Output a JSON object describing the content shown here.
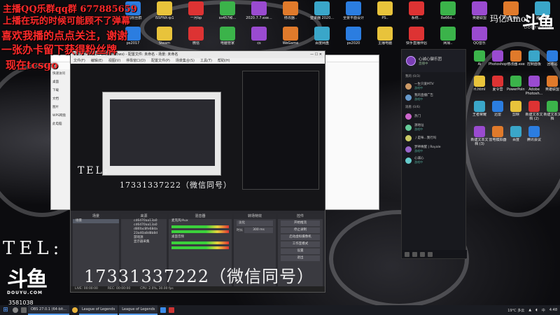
{
  "overlay": {
    "line1": "主播QQ乐群qq群 677885659",
    "line2": "上播在玩的时候可能顾不了弹幕",
    "line3": "喜欢我播的点点关注，谢谢",
    "line4": "一张办卡留下获得粉丝牌",
    "line5": "现在tcsgo"
  },
  "contact": {
    "tel_label": "TEL:",
    "phone": "17331337222（微信同号）",
    "tel_label_small": "TEL:",
    "phone_small": "17331337222（微信同号）"
  },
  "branding": {
    "streamer_name": "玛亿Amor",
    "logo_text": "斗鱼",
    "logo_domain": "DOUYU.COM",
    "viewer_count": "3581038"
  },
  "obs": {
    "title": "OBS 27.0.1 (64-bit, windows) - 配置文件: 未命名 - 场景: 未命名",
    "menu": [
      "文件(F)",
      "编辑(E)",
      "视图(V)",
      "停靠窗口(D)",
      "配置文件(P)",
      "场景集合(S)",
      "工具(T)",
      "帮助(H)"
    ],
    "panels": {
      "scenes": "场景",
      "sources": "来源",
      "mixer": "混音器",
      "transitions": "转场特效",
      "controls": "控件"
    },
    "scene_item": "场景",
    "sources": [
      "cd6470aa13a0",
      "cd6470aa13a0",
      "d86fac8fe68da",
      "23a40a8d8b8d",
      "游戏源",
      "显示器采集"
    ],
    "mixer_tracks": [
      "麦克风/Aux",
      "桌面音频"
    ],
    "transition_label": "淡化",
    "duration_label": "时长",
    "duration_value": "300 ms",
    "control_buttons": [
      "开始推流",
      "停止录制",
      "启动虚拟摄像机",
      "工作室模式",
      "设置",
      "退出"
    ],
    "status": {
      "live": "LIVE: 00:00:00",
      "rec": "REC: 00:00:00",
      "cpu": "CPU: 2.0%, 30.00 fps"
    }
  },
  "explorer": {
    "sidebar": [
      "快速访问",
      "桌面",
      "下载",
      "文档",
      "图片",
      "WPS网盘",
      "此电脑"
    ]
  },
  "chat": {
    "channel_name": "心诚心御乐团",
    "channel_sub": "直播中",
    "sections": [
      "我的 (0/3)",
      "观看 (0/6)"
    ],
    "users": [
      {
        "name": "一生只爱MTV",
        "sub": "游戏中"
      },
      {
        "name": "我的直播广告",
        "sub": "游戏中"
      },
      {
        "name": "热门",
        "sub": ""
      },
      {
        "name": "源地址",
        "sub": "游戏中"
      },
      {
        "name": "丿是咪...我行吗",
        "sub": ""
      },
      {
        "name": "梦神唤醒 | Royale",
        "sub": "游戏中"
      },
      {
        "name": "心诚心",
        "sub": "游戏中"
      }
    ]
  },
  "taskbar": {
    "apps": [
      "OBS 27.0.1 (64-bit...",
      "League of Legends",
      "League of Legends"
    ],
    "tray_temp": "19°C 多云",
    "tray_lang": "中",
    "time": "4:48"
  },
  "desktop_icons": [
    "主播粉丝群",
    "iSSFNX-ip1",
    "一月bp",
    "ss457和...",
    "2020.7.7.exe...",
    "修改器..",
    "登录器 2020...",
    "全景平面设计",
    "PS..",
    "系统...",
    "8a66d...",
    "英雄联盟",
    "网易云音乐",
    "腾讯QQ",
    "ps2017",
    "Steam",
    "微信",
    "电脑管家",
    "cs",
    "WeGame",
    "百度网盘",
    "ps2020",
    "主播电脑",
    "快手直播伴侣",
    "网易..",
    "QQ音乐"
  ],
  "desktop_icons_right": [
    "Ai",
    "Photoshop",
    "修改器.exe",
    "控制面板",
    "回收站",
    "rt.html",
    "夏令营",
    "PowerPoint",
    "Adobe Photosh...",
    "英雄联盟",
    "王者荣耀",
    "迅雷",
    "剪映",
    "新建文本文档 (2)",
    "新建文本文档",
    "新建文本文档 (3)",
    "雷电模拟器",
    "百度",
    "腾讯会议"
  ],
  "colors": {
    "overlay_red": "#ff2a2a",
    "accent_blue": "#5aa0ff",
    "obs_bg": "#1f1f23"
  }
}
